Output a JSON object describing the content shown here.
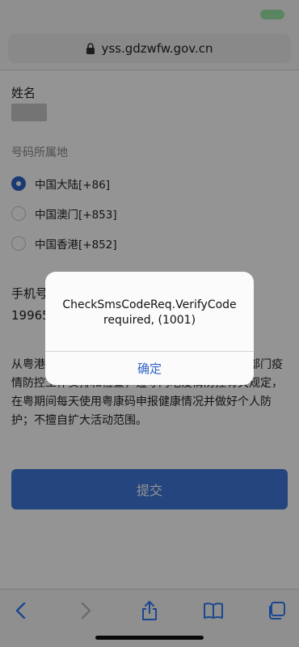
{
  "browser": {
    "url": "yss.gdzwfw.gov.cn"
  },
  "form": {
    "name_label": "姓名",
    "region_label": "号码所属地",
    "regions": [
      {
        "label": "中国大陆[+86]",
        "selected": true
      },
      {
        "label": "中国澳门[+853]",
        "selected": false
      },
      {
        "label": "中国香港[+852]",
        "selected": false
      }
    ],
    "phone_label": "手机号",
    "phone_value": "19965",
    "notice_text": "从粤港…入境前…，配合、服从内地各级政府及部门疫情防控工作安排和检查，遵守内地疫情防控有关规定，在粤期间每天使用粤康码申报健康情况并做好个人防护；不擅自扩大活动范围。",
    "submit_label": "提交"
  },
  "alert": {
    "message_line1": "CheckSmsCodeReq.VerifyCode",
    "message_line2": "required, (1001)",
    "ok_label": "确定"
  },
  "colors": {
    "accent": "#2f63c6",
    "submit": "#3f78d8"
  },
  "toolbar": {
    "icons": [
      "back-icon",
      "forward-icon",
      "share-icon",
      "bookmarks-icon",
      "tabs-icon"
    ]
  }
}
